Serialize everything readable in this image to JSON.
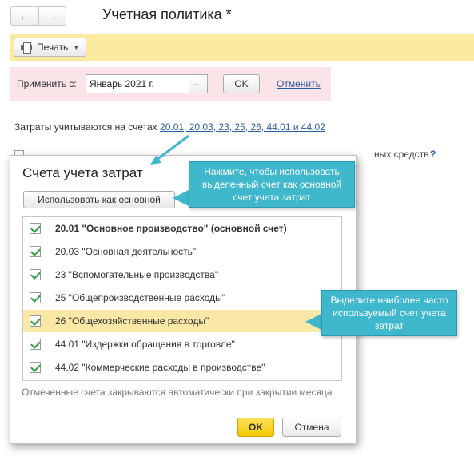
{
  "header": {
    "title": "Учетная политика *",
    "back_icon": "←",
    "forward_icon": "→"
  },
  "toolbar": {
    "print_label": "Печать",
    "print_caret": "▼"
  },
  "apply": {
    "label": "Применить с:",
    "date_value": "Январь 2021 г.",
    "select_button": "...",
    "ok_label": "OK",
    "cancel_label": "Отменить"
  },
  "accounts": {
    "prefix": "Затраты учитываются на счетах ",
    "link": "20.01, 20.03, 23, 25, 26, 44.01 и 44.02"
  },
  "background_row": {
    "partial_text": "ных средств",
    "help": "?"
  },
  "popup": {
    "title": "Счета учета затрат",
    "use_main_label": "Использовать как основной",
    "items": [
      {
        "label": "20.01 \"Основное производство\" (основной счет)",
        "checked": true
      },
      {
        "label": "20.03 \"Основная деятельность\"",
        "checked": true
      },
      {
        "label": "23 \"Вспомогательные производства\"",
        "checked": true
      },
      {
        "label": "25 \"Общепроизводственные расходы\"",
        "checked": true
      },
      {
        "label": "26 \"Общехозяйственные расходы\"",
        "checked": true
      },
      {
        "label": "44.01 \"Издержки обращения в торговле\"",
        "checked": true
      },
      {
        "label": "44.02 \"Коммерческие расходы в производстве\"",
        "checked": true
      }
    ],
    "footnote": "Отмеченные счета закрываются автоматически при закрытии месяца",
    "ok_label": "OK",
    "cancel_label": "Отмена"
  },
  "callouts": {
    "use_main_hint": "Нажмите, чтобы использовать выделенный счет как основной счет учета затрат",
    "select_hint": "Выделите наиболее часто используемый счет учета затрат"
  },
  "colors": {
    "toolbar_bg": "#fbeaa0",
    "apply_bg": "#fbe4e8",
    "link": "#2b5ca8",
    "selected_row": "#fae8a6",
    "callout": "#3fb7cc",
    "ok_button": "#f3c800",
    "check": "#2e9b3c"
  }
}
